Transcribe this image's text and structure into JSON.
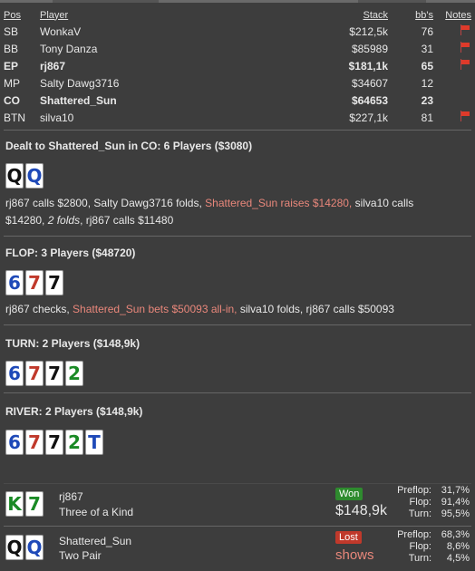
{
  "table": {
    "headers": {
      "pos": "Pos",
      "player": "Player",
      "stack": "Stack",
      "bbs": "bb's",
      "notes": "Notes"
    },
    "rows": [
      {
        "pos": "SB",
        "player": "WonkaV",
        "stack": "$212,5k",
        "bbs": "76",
        "flag": true,
        "bold": false
      },
      {
        "pos": "BB",
        "player": "Tony Danza",
        "stack": "$85989",
        "bbs": "31",
        "flag": true,
        "bold": false
      },
      {
        "pos": "EP",
        "player": "rj867",
        "stack": "$181,1k",
        "bbs": "65",
        "flag": true,
        "bold": true
      },
      {
        "pos": "MP",
        "player": "Salty Dawg3716",
        "stack": "$34607",
        "bbs": "12",
        "flag": false,
        "bold": false
      },
      {
        "pos": "CO",
        "player": "Shattered_Sun",
        "stack": "$64653",
        "bbs": "23",
        "flag": false,
        "bold": true
      },
      {
        "pos": "BTN",
        "player": "silva10",
        "stack": "$227,1k",
        "bbs": "81",
        "flag": true,
        "bold": false
      }
    ]
  },
  "preflop": {
    "title": "Dealt to Shattered_Sun in CO: 6 Players ($3080)",
    "cards": [
      {
        "rank": "Q",
        "suit": "spade"
      },
      {
        "rank": "Q",
        "suit": "diamond"
      }
    ],
    "action_1": "rj867 calls $2800, Salty Dawg3716 folds, ",
    "action_hl": "Shattered_Sun raises $14280,",
    "action_2": " silva10 calls",
    "action_3": "$14280, ",
    "action_em": "2 folds",
    "action_4": ", rj867 calls $11480"
  },
  "flop": {
    "title": "FLOP: 3 Players ($48720)",
    "cards": [
      {
        "rank": "6",
        "suit": "diamond"
      },
      {
        "rank": "7",
        "suit": "heart"
      },
      {
        "rank": "7",
        "suit": "spade"
      }
    ],
    "action_1": "rj867 checks, ",
    "action_hl": "Shattered_Sun bets $50093 all-in,",
    "action_2": " silva10 folds, rj867 calls $50093"
  },
  "turn": {
    "title": "TURN: 2 Players ($148,9k)",
    "cards": [
      {
        "rank": "6",
        "suit": "diamond"
      },
      {
        "rank": "7",
        "suit": "heart"
      },
      {
        "rank": "7",
        "suit": "spade"
      },
      {
        "rank": "2",
        "suit": "club"
      }
    ]
  },
  "river": {
    "title": "RIVER: 2 Players ($148,9k)",
    "cards": [
      {
        "rank": "6",
        "suit": "diamond"
      },
      {
        "rank": "7",
        "suit": "heart"
      },
      {
        "rank": "7",
        "suit": "spade"
      },
      {
        "rank": "2",
        "suit": "club"
      },
      {
        "rank": "T",
        "suit": "diamond"
      }
    ]
  },
  "results": [
    {
      "player": "rj867",
      "hand": "Three of a Kind",
      "cards": [
        {
          "rank": "K",
          "suit": "club"
        },
        {
          "rank": "7",
          "suit": "club"
        }
      ],
      "badge": "Won",
      "outcome": "$148,9k",
      "stats": [
        {
          "label": "Preflop:",
          "value": "31,7%"
        },
        {
          "label": "Flop:",
          "value": "91,4%"
        },
        {
          "label": "Turn:",
          "value": "95,5%"
        }
      ]
    },
    {
      "player": "Shattered_Sun",
      "hand": "Two Pair",
      "cards": [
        {
          "rank": "Q",
          "suit": "spade"
        },
        {
          "rank": "Q",
          "suit": "diamond"
        }
      ],
      "badge": "Lost",
      "outcome": "shows",
      "stats": [
        {
          "label": "Preflop:",
          "value": "68,3%"
        },
        {
          "label": "Flop:",
          "value": "8,6%"
        },
        {
          "label": "Turn:",
          "value": "4,5%"
        }
      ]
    }
  ],
  "colors": {
    "background": "#3d3d3d",
    "highlight": "#e9877b",
    "won": "#2e8b2e",
    "lost": "#c0392b"
  }
}
